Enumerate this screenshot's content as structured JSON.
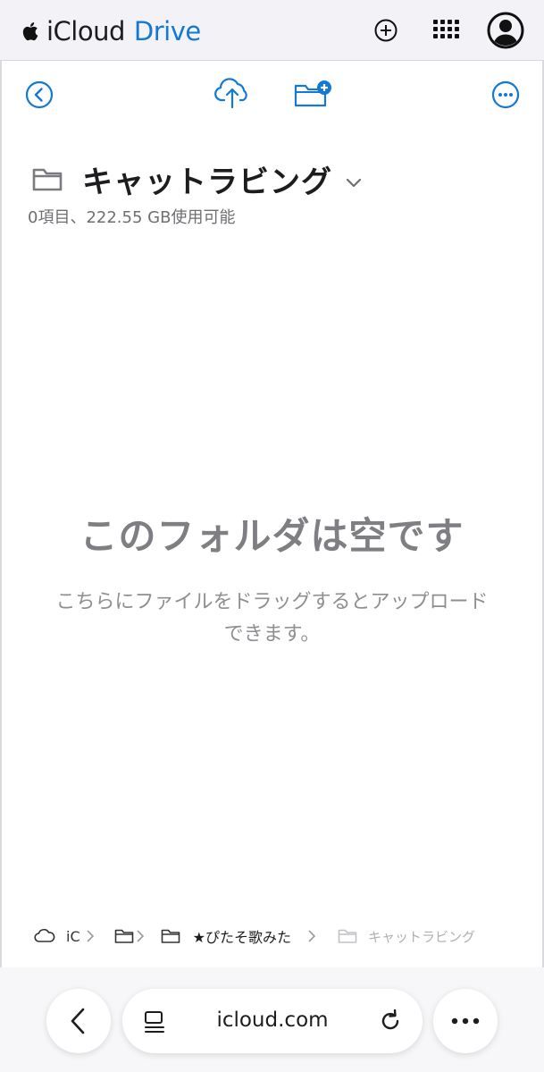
{
  "header": {
    "brand_prefix": "iCloud",
    "brand_suffix": "Drive",
    "icons": [
      "apple-logo-icon",
      "plus-circle-icon",
      "app-grid-icon",
      "account-icon"
    ]
  },
  "toolbar": {
    "icons": [
      "back-circle-icon",
      "upload-cloud-icon",
      "new-folder-icon",
      "more-circle-icon"
    ]
  },
  "folder": {
    "title": "キャットラビング",
    "meta": "0項目、222.55 GB使用可能"
  },
  "empty_state": {
    "title": "このフォルダは空です",
    "subtitle_line1": "こちらにファイルをドラッグするとアップロード",
    "subtitle_line2": "できます。"
  },
  "breadcrumb": {
    "items": [
      {
        "label": "iC",
        "icon": "cloud-icon"
      },
      {
        "label": "",
        "icon": "folder-icon"
      },
      {
        "label": "★ぴたそ歌みた",
        "icon": "folder-icon"
      },
      {
        "label": "キャットラビング",
        "icon": "folder-icon"
      }
    ]
  },
  "browser": {
    "url": "icloud.com",
    "icons": [
      "back-chevron-icon",
      "tabs-icon",
      "reload-icon",
      "more-dots-icon"
    ]
  },
  "colors": {
    "accent": "#1478d4",
    "header_bg": "#f2f2f7",
    "muted_text": "#8e8e93"
  }
}
